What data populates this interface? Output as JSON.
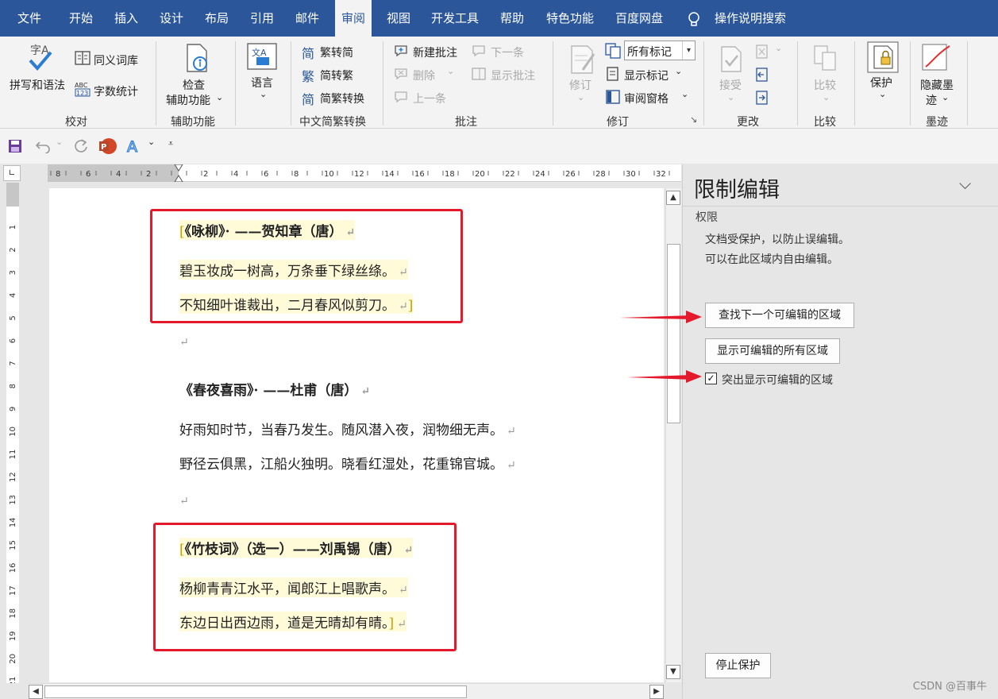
{
  "menu": {
    "tabs": [
      "文件",
      "开始",
      "插入",
      "设计",
      "布局",
      "引用",
      "邮件",
      "审阅",
      "视图",
      "开发工具",
      "帮助",
      "特色功能",
      "百度网盘"
    ],
    "active": "审阅",
    "tell_me": "操作说明搜索"
  },
  "ribbon": {
    "proofing": {
      "spelling": "拼写和语法",
      "thesaurus": "同义词库",
      "wordcount": "字数统计",
      "label": "校对"
    },
    "accessibility": {
      "check": "检查",
      "check2": "辅助功能",
      "label": "辅助功能"
    },
    "language": {
      "btn": "语言"
    },
    "chinese": {
      "to_simplified": "繁转简",
      "to_traditional": "简转繁",
      "convert": "简繁转换",
      "label": "中文简繁转换"
    },
    "comments": {
      "new": "新建批注",
      "delete": "删除",
      "prev": "上一条",
      "next": "下一条",
      "show": "显示批注",
      "label": "批注"
    },
    "tracking": {
      "track": "修订",
      "markup_select": "所有标记",
      "show_markup": "显示标记",
      "review_pane": "审阅窗格",
      "label": "修订"
    },
    "changes": {
      "accept": "接受",
      "label": "更改"
    },
    "compare": {
      "compare": "比较",
      "label": "比较"
    },
    "protect": {
      "protect": "保护"
    },
    "ink": {
      "hide1": "隐藏墨",
      "hide2": "迹",
      "label": "墨迹"
    }
  },
  "ruler": {
    "left_ticks": [
      "8",
      "6",
      "4",
      "2"
    ],
    "right_ticks": [
      "2",
      "4",
      "6",
      "8",
      "10",
      "12",
      "14",
      "16",
      "18",
      "20",
      "22",
      "24",
      "26",
      "28",
      "30",
      "32"
    ],
    "vertical_ticks": [
      "1",
      "2",
      "3",
      "4",
      "5",
      "6",
      "7",
      "8",
      "9",
      "10",
      "11",
      "12",
      "13",
      "14",
      "15",
      "16",
      "17",
      "18",
      "19",
      "20",
      "21"
    ]
  },
  "document": {
    "poem1": {
      "title": "《咏柳》· ——贺知章（唐）",
      "l1": "碧玉妆成一树高，万条垂下绿丝绦。",
      "l2": "不知细叶谁裁出，二月春风似剪刀。"
    },
    "poem2": {
      "title": "《春夜喜雨》· ——杜甫（唐）",
      "l1": "好雨知时节，当春乃发生。随风潜入夜，润物细无声。",
      "l2": "野径云俱黑，江船火独明。晓看红湿处，花重锦官城。"
    },
    "poem3": {
      "title": "《竹枝词》（选一）——刘禹锡（唐）",
      "l1": "杨柳青青江水平，闻郎江上唱歌声。",
      "l2": "东边日出西边雨，道是无晴却有晴。"
    },
    "para_mark": "↵"
  },
  "pane": {
    "title": "限制编辑",
    "section": "权限",
    "info1": "文档受保护，以防止误编辑。",
    "info2": "可以在此区域内自由编辑。",
    "find_next": "查找下一个可编辑的区域",
    "show_all": "显示可编辑的所有区域",
    "highlight_label": "突出显示可编辑的区域",
    "highlight_checked": true,
    "stop": "停止保护"
  },
  "watermark": "CSDN @百事牛",
  "colors": {
    "ribbon_blue": "#2b579a",
    "annotation_red": "#e4192b",
    "highlight_yellow": "#fffbd9"
  }
}
